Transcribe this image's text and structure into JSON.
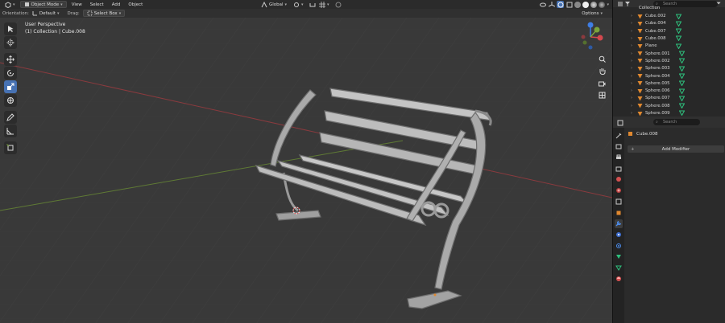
{
  "header": {
    "mode": "Object Mode",
    "menus": [
      "View",
      "Select",
      "Add",
      "Object"
    ],
    "transform_orientation": "Global",
    "options_label": "Options"
  },
  "toolbar2": {
    "orientation_label": "Orientation:",
    "orientation_value": "Default",
    "drag_label": "Drag:",
    "drag_value": "Select Box"
  },
  "viewport": {
    "perspective": "User Perspective",
    "collection_info": "(1) Collection | Cube.008"
  },
  "outliner": {
    "search_placeholder": "Search",
    "header_item": "Collection",
    "items": [
      {
        "name": "Cube.002",
        "icon": "mesh-icon",
        "modifier": "vertex-group-icon",
        "selected": false
      },
      {
        "name": "Cube.004",
        "icon": "mesh-icon",
        "modifier": "vertex-group-icon",
        "selected": false
      },
      {
        "name": "Cube.007",
        "icon": "mesh-icon",
        "modifier": "vertex-group-icon",
        "selected": false
      },
      {
        "name": "Cube.008",
        "icon": "mesh-icon",
        "modifier": "vertex-group-icon",
        "selected": false
      },
      {
        "name": "Plane",
        "icon": "mesh-icon",
        "modifier": "vertex-group-icon",
        "selected": false
      },
      {
        "name": "Sphere.001",
        "icon": "mesh-icon",
        "modifier": "vertex-group-icon",
        "selected": false
      },
      {
        "name": "Sphere.002",
        "icon": "mesh-icon",
        "modifier": "vertex-group-icon",
        "selected": false
      },
      {
        "name": "Sphere.003",
        "icon": "mesh-icon",
        "modifier": "vertex-group-icon",
        "selected": false
      },
      {
        "name": "Sphere.004",
        "icon": "mesh-icon",
        "modifier": "vertex-group-icon",
        "selected": false
      },
      {
        "name": "Sphere.005",
        "icon": "mesh-icon",
        "modifier": "vertex-group-icon",
        "selected": false
      },
      {
        "name": "Sphere.006",
        "icon": "mesh-icon",
        "modifier": "vertex-group-icon",
        "selected": false
      },
      {
        "name": "Sphere.007",
        "icon": "mesh-icon",
        "modifier": "vertex-group-icon",
        "selected": false
      },
      {
        "name": "Sphere.008",
        "icon": "mesh-icon",
        "modifier": "vertex-group-icon",
        "selected": false
      },
      {
        "name": "Sphere.009",
        "icon": "mesh-icon",
        "modifier": "vertex-group-icon",
        "selected": false
      }
    ]
  },
  "properties": {
    "search_placeholder": "Search",
    "object_name": "Cube.008",
    "add_modifier_label": "Add Modifier"
  },
  "colors": {
    "accent_blue": "#4772b3",
    "mesh_orange": "#e0882f",
    "modifier_green": "#2ec27e",
    "axis_x_red": "#d3484e",
    "axis_y_green": "#7ba43a",
    "gizmo_z_blue": "#3f7ee5"
  }
}
